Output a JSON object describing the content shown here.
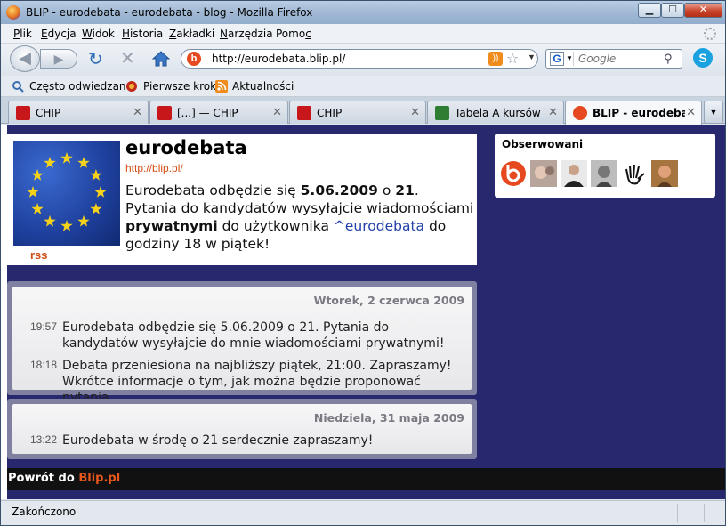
{
  "window": {
    "title": "BLIP - eurodebata - eurodebata - blog - Mozilla Firefox",
    "min_label": "▁",
    "max_label": "☐",
    "close_label": "✕"
  },
  "menu": [
    "Plik",
    "Edycja",
    "Widok",
    "Historia",
    "Zakładki",
    "Narzędzia",
    "Pomoc"
  ],
  "menu_accel": [
    "P",
    "E",
    "W",
    "H",
    "Z",
    "N",
    "c"
  ],
  "nav": {
    "url": "http://eurodebata.blip.pl/",
    "search_placeholder": "Google",
    "back_glyph": "◀",
    "fwd_glyph": "▶",
    "reload_glyph": "↻",
    "stop_glyph": "✕",
    "star_glyph": "☆",
    "drop_glyph": "▼",
    "search_glyph": "⚲",
    "engine_letter": "G",
    "skype_letter": "S",
    "favicon_letter": "b",
    "rss_glyph": "))"
  },
  "bookmarks": [
    "Często odwiedzane",
    "Pierwsze kroki",
    "Aktualności"
  ],
  "tabs": [
    {
      "label": "CHIP",
      "close": "✕"
    },
    {
      "label": "[...] — CHIP",
      "close": "✕"
    },
    {
      "label": "CHIP",
      "close": "✕"
    },
    {
      "label": "Tabela A kursów ...",
      "close": "✕"
    },
    {
      "label": "BLIP - eurodeba...",
      "close": "✕"
    }
  ],
  "tab_list_glyph": "▼",
  "profile": {
    "name": "eurodebata",
    "url": "http://blip.pl/",
    "rss": "rss",
    "desc_parts": [
      "Eurodebata odbędzie się ",
      "5.06.2009",
      " o ",
      "21",
      ". Pytania do kandydatów wysyłajcie wiadomościami ",
      "prywatnymi",
      " do użytkownika ",
      "^eurodebata",
      " do godziny 18 w piątek!"
    ]
  },
  "observed": {
    "title": "Obserwowani"
  },
  "days": [
    {
      "date": "Wtorek, 2 czerwca 2009",
      "entries": [
        {
          "time": "19:57",
          "text": "Eurodebata odbędzie się 5.06.2009 o 21. Pytania do kandydatów wysyłajcie do mnie wiadomościami prywatnymi!"
        },
        {
          "time": "18:18",
          "text": "Debata przeniesiona na najbliższy piątek, 21:00. Zapraszamy! Wkrótce informacje o tym, jak można będzie proponować pytania."
        }
      ]
    },
    {
      "date": "Niedziela, 31 maja 2009",
      "entries": [
        {
          "time": "13:22",
          "text": "Eurodebata w środę o 21 serdecznie zapraszamy!"
        }
      ]
    }
  ],
  "footer": {
    "prefix": "Powrót do ",
    "link": "Blip.pl"
  },
  "status": "Zakończono",
  "colors": {
    "page_bg": "#28286e",
    "accent_orange": "#d24e16",
    "link_blue": "#2340a8",
    "blip_red": "#e6491f"
  }
}
